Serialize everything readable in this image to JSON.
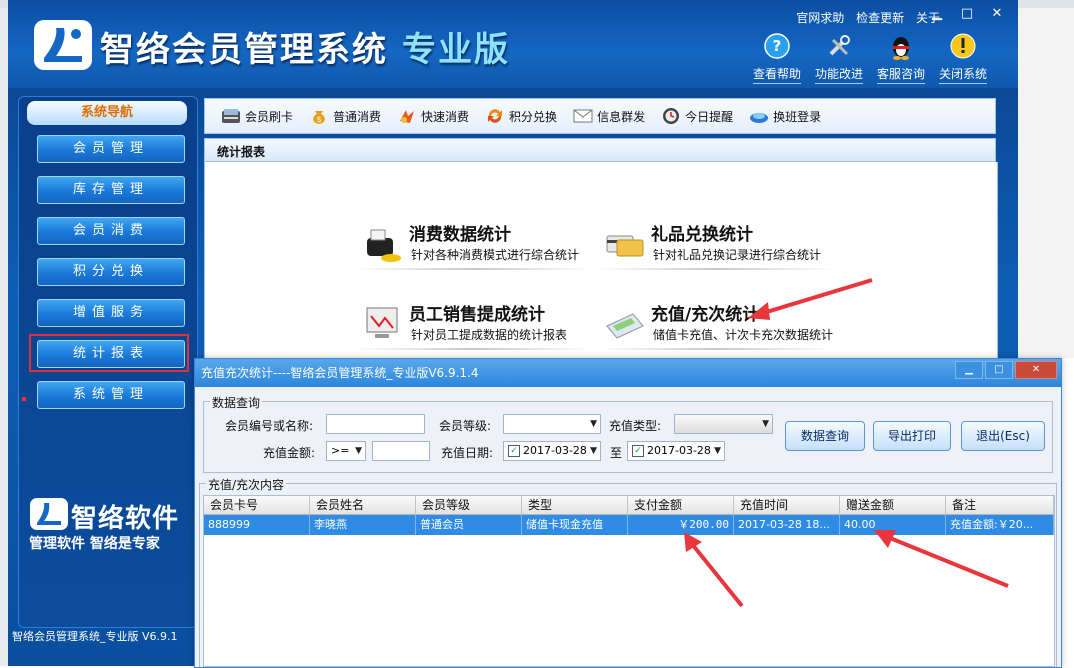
{
  "app": {
    "title": "智络会员管理系统",
    "edition": "专业版",
    "top_links": [
      "官网求助",
      "检查更新",
      "关于"
    ],
    "window_controls": [
      "▁",
      "□",
      "✕"
    ],
    "top_tools": [
      {
        "label": "查看帮助",
        "icon": "help-icon"
      },
      {
        "label": "功能改进",
        "icon": "tools-icon"
      },
      {
        "label": "客服咨询",
        "icon": "qq-penguin-icon"
      },
      {
        "label": "关闭系统",
        "icon": "warning-icon"
      }
    ]
  },
  "sidebar": {
    "header": "系统导航",
    "items": [
      {
        "label": "会员管理"
      },
      {
        "label": "库存管理"
      },
      {
        "label": "会员消费"
      },
      {
        "label": "积分兑换"
      },
      {
        "label": "增值服务"
      },
      {
        "label": "统计报表"
      },
      {
        "label": "系统管理"
      }
    ],
    "active_index": 5,
    "brand_name": "智络软件",
    "brand_slogan": "管理软件 智络是专家"
  },
  "status_bar": "智络会员管理系统_专业版 V6.9.1",
  "toolbar": [
    {
      "label": "会员刷卡",
      "icon": "card-reader-icon"
    },
    {
      "label": "普通消费",
      "icon": "money-bag-icon"
    },
    {
      "label": "快速消费",
      "icon": "fast-consume-icon"
    },
    {
      "label": "积分兑换",
      "icon": "exchange-icon"
    },
    {
      "label": "信息群发",
      "icon": "envelope-icon"
    },
    {
      "label": "今日提醒",
      "icon": "clock-icon"
    },
    {
      "label": "换班登录",
      "icon": "shift-login-icon"
    }
  ],
  "panel_title": "统计报表",
  "reports": [
    {
      "title": "消费数据统计",
      "desc": "针对各种消费模式进行综合统计",
      "icon": "pos-machine-icon"
    },
    {
      "title": "礼品兑换统计",
      "desc": "针对礼品兑换记录进行综合统计",
      "icon": "cards-icon"
    },
    {
      "title": "员工销售提成统计",
      "desc": "针对员工提成数据的统计报表",
      "icon": "chart-monitor-icon"
    },
    {
      "title": "充值/充次统计",
      "desc": "储值卡充值、计次卡充次数据统计",
      "icon": "calculator-icon"
    }
  ],
  "dialog": {
    "title": "充值充次统计----智络会员管理系统_专业版V6.9.1.4",
    "query_group": "数据查询",
    "fields": {
      "member_no_label": "会员编号或名称:",
      "member_no_value": "",
      "level_label": "会员等级:",
      "level_value": "",
      "type_label": "充值类型:",
      "type_value": "",
      "amount_label": "充值金额:",
      "amount_op": ">=",
      "amount_value": "",
      "date_label": "充值日期:",
      "date_from": "2017-03-28",
      "date_to_label": "至",
      "date_to": "2017-03-28"
    },
    "buttons": {
      "query": "数据查询",
      "export": "导出打印",
      "exit": "退出(Esc)"
    },
    "content_group": "充值/充次内容",
    "table": {
      "columns": [
        "会员卡号",
        "会员姓名",
        "会员等级",
        "类型",
        "支付金额",
        "充值时间",
        "赠送金额",
        "备注"
      ],
      "rows": [
        [
          "888999",
          "李晓燕",
          "普通会员",
          "储值卡现金充值",
          "￥200.00",
          "2017-03-28 18...",
          "40.00",
          "充值金额:￥20..."
        ]
      ]
    }
  },
  "colors": {
    "header_blue": "#0b4da3",
    "nav_button": "#1b78d8",
    "active_outline": "#e0303a",
    "selected_row": "#2f8be3",
    "annotation_arrow": "#e8363b"
  }
}
